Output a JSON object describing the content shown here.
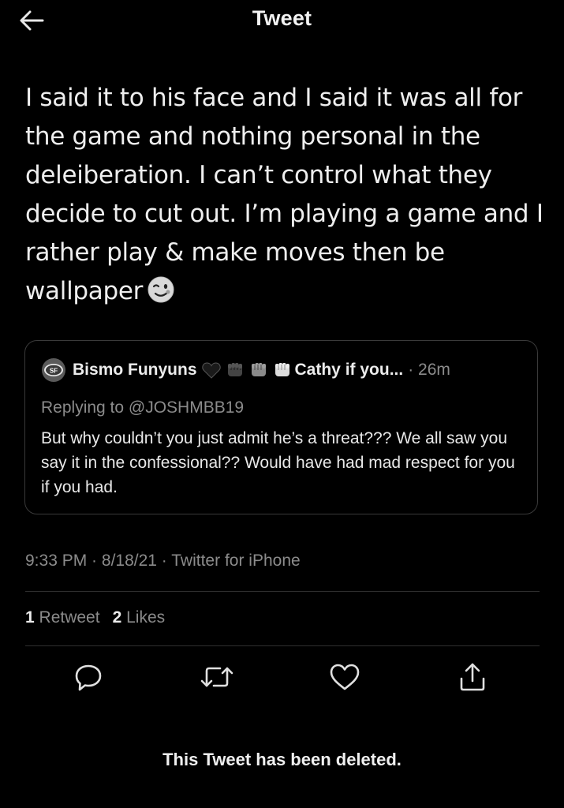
{
  "header": {
    "title": "Tweet",
    "back_icon": "arrow-left-icon"
  },
  "tweet": {
    "text": "I said it to his face and I said it was all for the game and nothing personal in the deleiberation. I can’t control what they decide to cut out. I’m playing a game and I rather play & make moves then be wallpaper",
    "emoji": "winking-face-icon"
  },
  "quote": {
    "avatar_icon": "49ers-logo-icon",
    "name": "Bismo Funyuns",
    "name_emojis": [
      "black-heart-icon",
      "raised-fist-dark-icon",
      "raised-fist-medium-icon",
      "raised-fist-light-icon"
    ],
    "name_suffix": "Cathy if you...",
    "time": "· 26m",
    "replying_to": "Replying to @JOSHMBB19",
    "body": "But why couldn’t you just admit he’s a threat??? We all saw you say it in the confessional?? Would have had mad respect for you if you had."
  },
  "meta": {
    "time": "9:33 PM",
    "sep1": " · ",
    "date": "8/18/21",
    "sep2": " · ",
    "source": "Twitter for iPhone"
  },
  "stats": {
    "retweets_count": "1",
    "retweets_label": "Retweet",
    "likes_count": "2",
    "likes_label": "Likes"
  },
  "actions": [
    "reply-icon",
    "retweet-icon",
    "like-icon",
    "share-icon"
  ],
  "footer": {
    "deleted_text": "This Tweet has been deleted."
  },
  "colors": {
    "background": "#000000",
    "text": "#eeeeee",
    "muted": "#8b8b8b",
    "border": "#3a3a3a"
  }
}
